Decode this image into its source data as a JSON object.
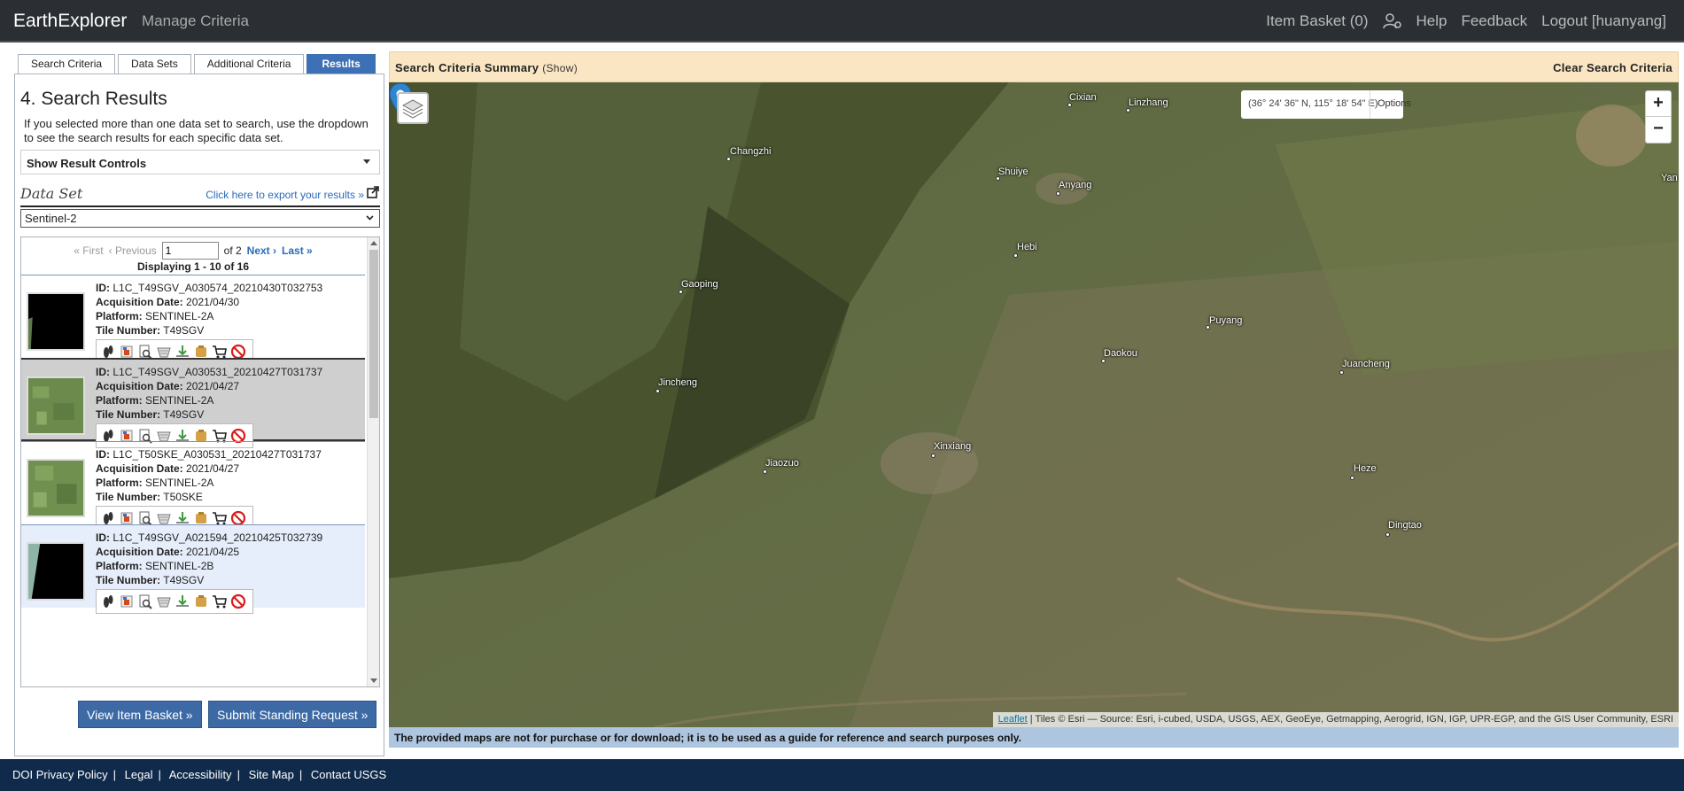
{
  "nav": {
    "brand": "EarthExplorer",
    "manage": "Manage Criteria",
    "item_basket": "Item Basket (0)",
    "help": "Help",
    "feedback": "Feedback",
    "logout": "Logout [huanyang]"
  },
  "tabs": [
    "Search Criteria",
    "Data Sets",
    "Additional Criteria",
    "Results"
  ],
  "results": {
    "title": "4. Search Results",
    "description": "If you selected more than one data set to search, use the dropdown to see the search results for each specific data set.",
    "show_controls": "Show Result Controls",
    "dataset_label": "Data Set",
    "export_link": "Click here to export your results »",
    "dataset_value": "Sentinel-2",
    "pager": {
      "first": "« First",
      "previous": "‹ Previous",
      "page": "1",
      "of": "of 2",
      "next": "Next ›",
      "last": "Last »"
    },
    "displaying": "Displaying 1 - 10 of 16",
    "labels": {
      "id": "ID:",
      "acq": "Acquisition Date:",
      "platform": "Platform:",
      "tile": "Tile Number:"
    },
    "items": [
      {
        "id": "L1C_T49SGV_A030574_20210430T032753",
        "acq": "2021/04/30",
        "platform": "SENTINEL-2A",
        "tile": "T49SGV"
      },
      {
        "id": "L1C_T49SGV_A030531_20210427T031737",
        "acq": "2021/04/27",
        "platform": "SENTINEL-2A",
        "tile": "T49SGV"
      },
      {
        "id": "L1C_T50SKE_A030531_20210427T031737",
        "acq": "2021/04/27",
        "platform": "SENTINEL-2A",
        "tile": "T50SKE"
      },
      {
        "id": "L1C_T49SGV_A021594_20210425T032739",
        "acq": "2021/04/25",
        "platform": "SENTINEL-2B",
        "tile": "T49SGV"
      }
    ],
    "view_basket": "View Item Basket »",
    "submit_standing": "Submit Standing Request »"
  },
  "map": {
    "criteria_label": "Search Criteria Summary",
    "criteria_show": "(Show)",
    "clear": "Clear Search Criteria",
    "coords": "(36° 24' 36\" N, 115° 18' 54\" E)",
    "options": "Options",
    "zoom_in": "+",
    "zoom_out": "−",
    "attribution_leaflet": "Leaflet",
    "attribution_rest": " | Tiles © Esri — Source: Esri, i-cubed, USDA, USGS, AEX, GeoEye, Getmapping, Aerogrid, IGN, IGP, UPR-EGP, and the GIS User Community, ESRI",
    "notice": "The provided maps are not for purchase or for download; it is to be used as a guide for reference and search purposes only.",
    "cities": [
      "Changzhi",
      "Cixian",
      "Linzhang",
      "Shuiye",
      "Anyang",
      "Yan",
      "Hebi",
      "Gaoping",
      "Puyang",
      "Daokou",
      "Juancheng",
      "Jincheng",
      "Xinxiang",
      "Jiaozuo",
      "Heze",
      "Dingtao"
    ]
  },
  "footer": {
    "privacy": "DOI Privacy Policy",
    "legal": "Legal",
    "accessibility": "Accessibility",
    "sitemap": "Site Map",
    "contact": "Contact USGS"
  }
}
